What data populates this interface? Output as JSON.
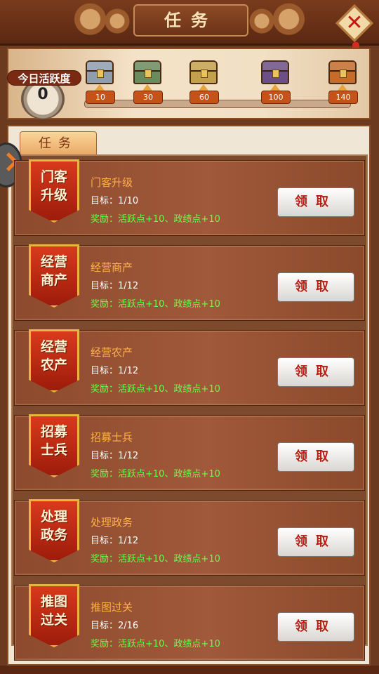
{
  "header": {
    "title": "任务"
  },
  "activity": {
    "label": "今日活跃度",
    "value": "0",
    "progress_fraction": 0,
    "milestones": [
      {
        "value": "10",
        "chest_color": "#8f9dad"
      },
      {
        "value": "30",
        "chest_color": "#6b8a5e"
      },
      {
        "value": "60",
        "chest_color": "#c3a04d"
      },
      {
        "value": "100",
        "chest_color": "#6b5086"
      },
      {
        "value": "140",
        "chest_color": "#c46c2b"
      }
    ]
  },
  "tabs": [
    {
      "label": "任务"
    }
  ],
  "tasks": [
    {
      "icon": "门客升级",
      "name": "门客升级",
      "goal": "目标：1/10",
      "reward": "奖励：活跃点+10、政绩点+10",
      "button": "领取"
    },
    {
      "icon": "经营商产",
      "name": "经营商产",
      "goal": "目标：1/12",
      "reward": "奖励：活跃点+10、政绩点+10",
      "button": "领取"
    },
    {
      "icon": "经营农产",
      "name": "经营农产",
      "goal": "目标：1/12",
      "reward": "奖励：活跃点+10、政绩点+10",
      "button": "领取"
    },
    {
      "icon": "招募士兵",
      "name": "招募士兵",
      "goal": "目标：1/12",
      "reward": "奖励：活跃点+10、政绩点+10",
      "button": "领取"
    },
    {
      "icon": "处理政务",
      "name": "处理政务",
      "goal": "目标：1/12",
      "reward": "奖励：活跃点+10、政绩点+10",
      "button": "领取"
    },
    {
      "icon": "推图过关",
      "name": "推图过关",
      "goal": "目标：2/16",
      "reward": "奖励：活跃点+10、政绩点+10",
      "button": "领取"
    }
  ],
  "colors": {
    "task_name": "#ffb04a",
    "reward": "#63ff4b",
    "button_text": "#b71b12",
    "accent_red": "#c41a14"
  },
  "icons": {
    "close": "close-icon",
    "side_toggle": "chevron-right-icon"
  }
}
